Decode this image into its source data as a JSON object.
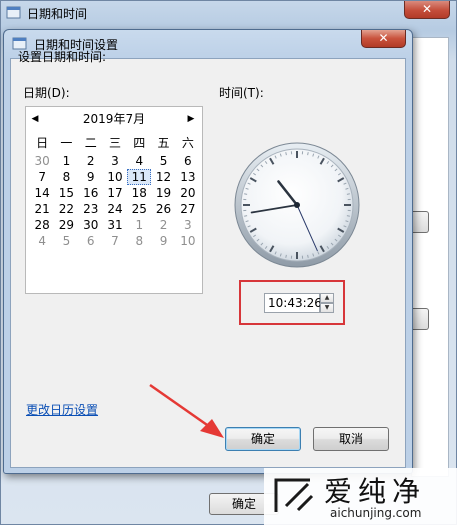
{
  "parent_window": {
    "title": "日期和时间",
    "close_symbol": "✕",
    "ok_label": "确定"
  },
  "dialog": {
    "title": "日期和时间设置",
    "close_symbol": "✕",
    "heading": "设置日期和时间:",
    "date_label": "日期(D):",
    "time_label": "时间(T):",
    "calendar": {
      "prev_symbol": "◀",
      "next_symbol": "▶",
      "month_label": "2019年7月",
      "weekdays": [
        "日",
        "一",
        "二",
        "三",
        "四",
        "五",
        "六"
      ],
      "weeks": [
        [
          {
            "d": "30",
            "other": true
          },
          {
            "d": "1"
          },
          {
            "d": "2"
          },
          {
            "d": "3"
          },
          {
            "d": "4"
          },
          {
            "d": "5"
          },
          {
            "d": "6"
          }
        ],
        [
          {
            "d": "7"
          },
          {
            "d": "8"
          },
          {
            "d": "9"
          },
          {
            "d": "10"
          },
          {
            "d": "11",
            "today": true
          },
          {
            "d": "12"
          },
          {
            "d": "13"
          }
        ],
        [
          {
            "d": "14"
          },
          {
            "d": "15"
          },
          {
            "d": "16"
          },
          {
            "d": "17"
          },
          {
            "d": "18"
          },
          {
            "d": "19"
          },
          {
            "d": "20"
          }
        ],
        [
          {
            "d": "21"
          },
          {
            "d": "22"
          },
          {
            "d": "23"
          },
          {
            "d": "24"
          },
          {
            "d": "25"
          },
          {
            "d": "26"
          },
          {
            "d": "27"
          }
        ],
        [
          {
            "d": "28"
          },
          {
            "d": "29"
          },
          {
            "d": "30"
          },
          {
            "d": "31"
          },
          {
            "d": "1",
            "other": true
          },
          {
            "d": "2",
            "other": true
          },
          {
            "d": "3",
            "other": true
          }
        ],
        [
          {
            "d": "4",
            "other": true
          },
          {
            "d": "5",
            "other": true
          },
          {
            "d": "6",
            "other": true
          },
          {
            "d": "7",
            "other": true
          },
          {
            "d": "8",
            "other": true
          },
          {
            "d": "9",
            "other": true
          },
          {
            "d": "10",
            "other": true
          }
        ]
      ]
    },
    "clock_time": {
      "hour": 10,
      "minute": 43,
      "second": 26
    },
    "time_value": "10:43:26",
    "change_calendar_link": "更改日历设置",
    "ok_label": "确定",
    "cancel_label": "取消"
  },
  "watermark": {
    "text": "爱纯净",
    "url": "aichunjing.com"
  },
  "colors": {
    "highlight_box": "#d7363a",
    "arrow": "#e53935",
    "link": "#0b4fb5"
  }
}
